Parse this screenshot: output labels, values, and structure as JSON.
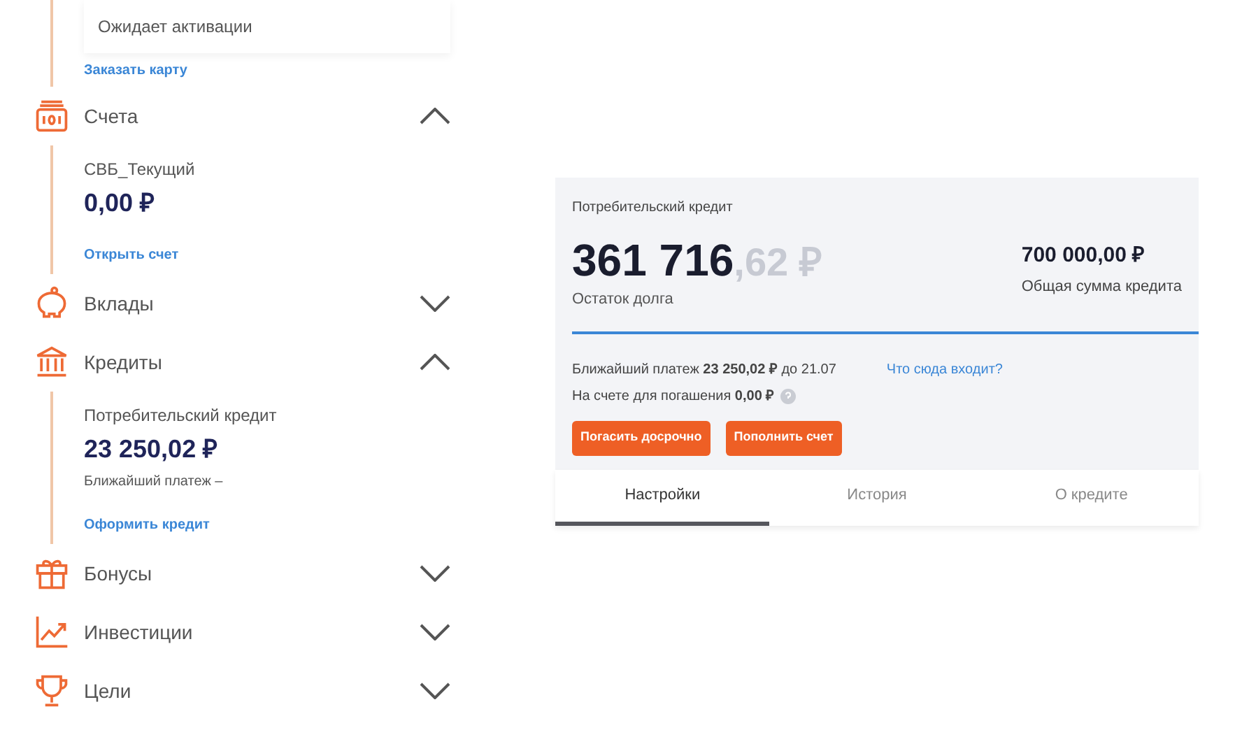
{
  "top_card": {
    "status": "Ожидает активации",
    "link": "Заказать карту"
  },
  "sections": [
    {
      "title": "Счета",
      "expanded": true,
      "items": [
        {
          "name": "СВБ_Текущий",
          "amount": "0,00 ₽"
        }
      ],
      "link": "Открыть счет"
    },
    {
      "title": "Вклады",
      "expanded": false
    },
    {
      "title": "Кредиты",
      "expanded": true,
      "items": [
        {
          "name": "Потребительский кредит",
          "amount": "23 250,02 ₽",
          "note": "Ближайший платеж –"
        }
      ],
      "link": "Оформить кредит"
    },
    {
      "title": "Бонусы",
      "expanded": false
    },
    {
      "title": "Инвестиции",
      "expanded": false
    },
    {
      "title": "Цели",
      "expanded": false
    }
  ],
  "loan": {
    "title": "Потребительский кредит",
    "balance_main": "361 716",
    "balance_fraction": ",62 ₽",
    "balance_label": "Остаток долга",
    "total": "700 000,00 ₽",
    "total_label": "Общая сумма кредита",
    "next_payment": "Ближайший платеж **23 250,02 ₽** до 21.07",
    "info_link": "Что сюда входит?",
    "account_balance": "На счете для погашения **0,00 ₽**",
    "buttons": [
      "Погасить досрочно",
      "Пополнить счет"
    ],
    "tabs": [
      {
        "label": "Настройки",
        "selected": true
      },
      {
        "label": "История",
        "selected": false
      },
      {
        "label": "О кредите",
        "selected": false
      }
    ]
  }
}
